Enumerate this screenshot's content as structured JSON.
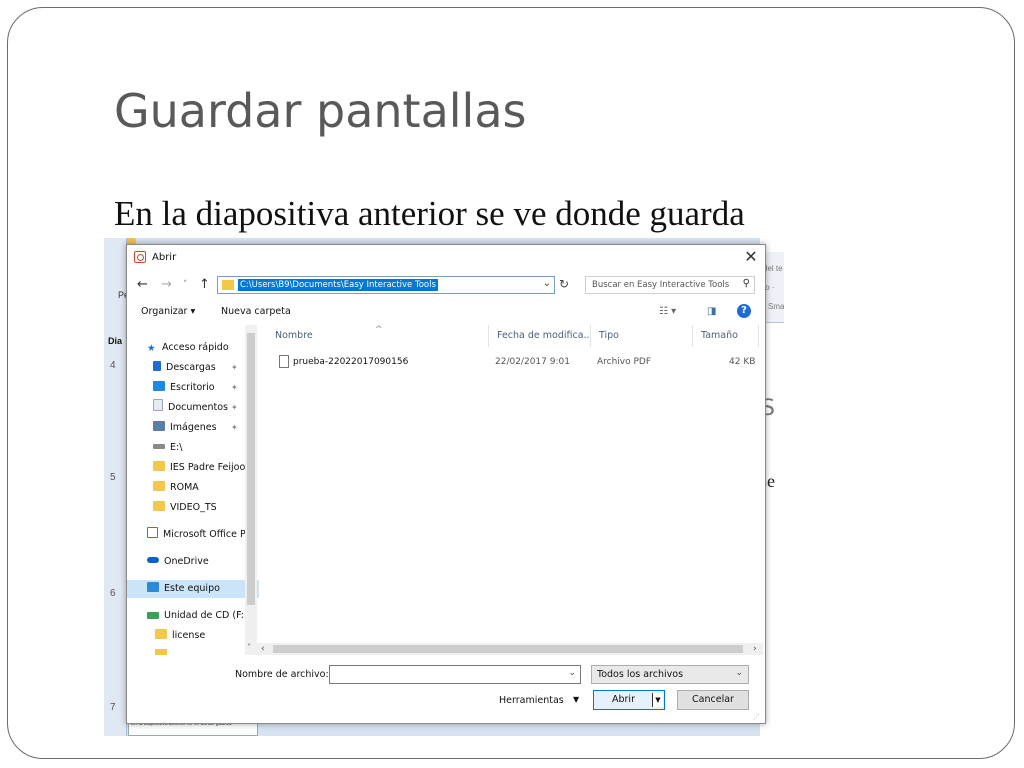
{
  "slide": {
    "title": "Guardar pantallas",
    "body": "En la diapositiva anterior se ve donde guarda"
  },
  "background": {
    "left_label": "Pe",
    "tab_label": "Dia",
    "slide_numbers": [
      "4",
      "5",
      "6",
      "7"
    ],
    "right_ribbon": [
      "del te",
      "to ·",
      "Sma"
    ],
    "right_text_1": "S",
    "right_text_2": "r se",
    "thumb_text": "En la diapositiva anterior se ve donde guarda"
  },
  "dialog": {
    "title": "Abrir",
    "close": "✕",
    "nav": {
      "back": "←",
      "forward": "→",
      "recent": "˅",
      "up": "↑"
    },
    "address": "C:\\Users\\B9\\Documents\\Easy Interactive Tools",
    "search_placeholder": "Buscar en Easy Interactive Tools",
    "toolbar": {
      "organize": "Organizar ▾",
      "new_folder": "Nueva carpeta",
      "help": "?"
    },
    "nav_items": [
      {
        "label": "Acceso rápido",
        "icon": "star-icon",
        "color": "#1f6bd1"
      },
      {
        "label": "Descargas",
        "icon": "download-icon",
        "color": "#1f6bd1",
        "pinned": true
      },
      {
        "label": "Escritorio",
        "icon": "desktop-icon",
        "color": "#1e88e5",
        "pinned": true
      },
      {
        "label": "Documentos",
        "icon": "document-icon",
        "color": "#9aa7b5",
        "pinned": true
      },
      {
        "label": "Imágenes",
        "icon": "image-icon",
        "color": "#5b7ea7",
        "pinned": true
      },
      {
        "label": "E:\\",
        "icon": "drive-icon",
        "color": "#8a8a8a"
      },
      {
        "label": "IES Padre Feijoo",
        "icon": "folder-icon",
        "color": "#f3c84a"
      },
      {
        "label": "ROMA",
        "icon": "folder-icon",
        "color": "#f3c84a"
      },
      {
        "label": "VIDEO_TS",
        "icon": "folder-icon",
        "color": "#f3c84a"
      },
      {
        "label": "Microsoft Office P",
        "icon": "office-icon",
        "color": "#d9472b"
      },
      {
        "label": "OneDrive",
        "icon": "cloud-icon",
        "color": "#0a64c7"
      },
      {
        "label": "Este equipo",
        "icon": "computer-icon",
        "color": "#2b8ad8",
        "selected": true
      },
      {
        "label": "Unidad de CD (F:)",
        "icon": "cd-drive-icon",
        "color": "#3aa05a"
      },
      {
        "label": "license",
        "icon": "folder-icon",
        "color": "#f3c84a"
      },
      {
        "label": "...",
        "icon": "folder-icon",
        "color": "#f3c84a"
      }
    ],
    "pin_glyph": "📌",
    "columns": [
      "Nombre",
      "Fecha de modifica...",
      "Tipo",
      "Tamaño"
    ],
    "files": [
      {
        "name": "prueba-22022017090156",
        "date": "22/02/2017 9:01",
        "type": "Archivo PDF",
        "size": "42 KB"
      }
    ],
    "filename_label": "Nombre de archivo:",
    "filename_value": "",
    "filter": "Todos los archivos",
    "tools": "Herramientas",
    "open": "Abrir",
    "cancel": "Cancelar"
  }
}
